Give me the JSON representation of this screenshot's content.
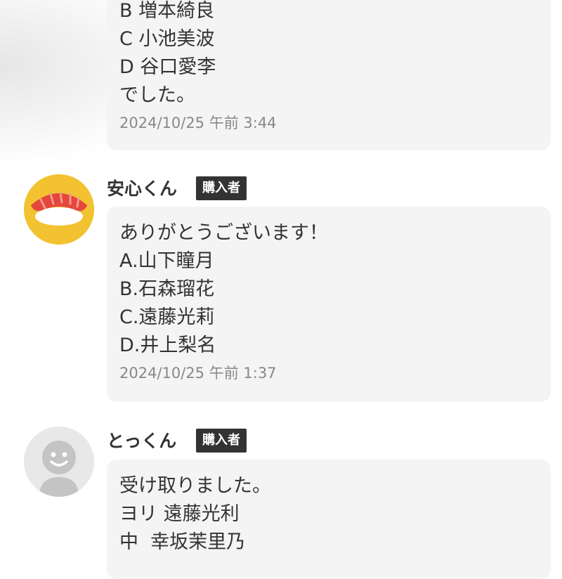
{
  "comments": [
    {
      "lines": [
        "B 増本綺良",
        "C 小池美波",
        "D 谷口愛李",
        "でした。"
      ],
      "timestamp": "2024/10/25 午前 3:44"
    },
    {
      "username": "安心くん",
      "badge": "購入者",
      "avatar_icon": "sushi-avatar-icon",
      "avatar_bg": "#f2c230",
      "lines": [
        "ありがとうございます！",
        "A.山下瞳月",
        "B.石森瑠花",
        "C.遠藤光莉",
        "D.井上梨名"
      ],
      "timestamp": "2024/10/25 午前 1:37"
    },
    {
      "username": "とっくん",
      "badge": "購入者",
      "avatar_icon": "default-user-avatar-icon",
      "avatar_bg": "#e8e8e8",
      "lines": [
        "受け取りました。",
        "ヨリ 遠藤光利",
        "中  幸坂茉里乃"
      ]
    }
  ],
  "colors": {
    "bubble_bg": "#f4f4f4",
    "badge_bg": "#333333",
    "text": "#333333",
    "timestamp": "#888888"
  }
}
